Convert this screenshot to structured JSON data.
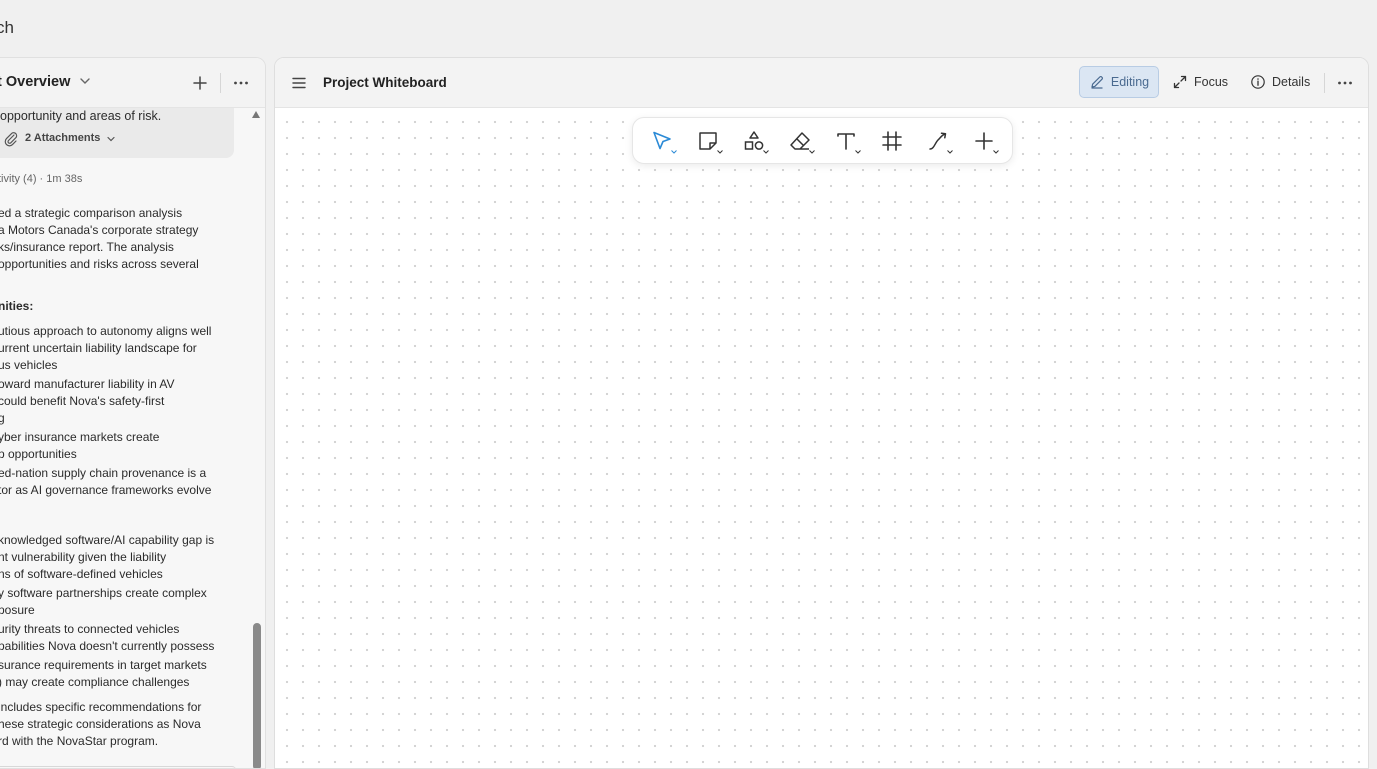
{
  "app": {
    "title_partial": "ch"
  },
  "left_panel": {
    "title": "t Overview",
    "card": {
      "text": "opportunity and areas of risk.",
      "attachments_label": "2 Attachments"
    },
    "activity": "tivity (4) · 1m 38s",
    "intro_lines": [
      "ed a strategic comparison analysis",
      "a Motors Canada's corporate strategy",
      "ks/insurance report. The analysis",
      " opportunities and risks across several"
    ],
    "opportunities_heading": "nities:",
    "opportunities_lines": [
      "utious approach to autonomy aligns well",
      "urrent uncertain liability landscape for",
      "us vehicles",
      "oward manufacturer liability in AV",
      "could benefit Nova's safety-first",
      "g",
      "yber insurance markets create",
      "p opportunities",
      "ed-nation supply chain provenance is a",
      "tor as AI governance frameworks evolve"
    ],
    "risks_lines": [
      "knowledged software/AI capability gap is",
      "nt vulnerability given the liability",
      "ns of software-defined vehicles",
      "y software partnerships create complex",
      "posure",
      "urity threats to connected vehicles",
      "pabilities Nova doesn't currently possess",
      "surance requirements in target markets",
      ") may create compliance challenges"
    ],
    "closing_lines": [
      "includes specific recommendations for",
      "hese strategic considerations as Nova",
      "rd with the NovaStar program."
    ]
  },
  "right_panel": {
    "title": "Project Whiteboard",
    "editing_label": "Editing",
    "focus_label": "Focus",
    "details_label": "Details"
  },
  "toolbar": {
    "tools": [
      {
        "name": "select",
        "icon": "cursor-arrow-icon",
        "active": true
      },
      {
        "name": "note",
        "icon": "sticky-note-icon"
      },
      {
        "name": "shapes",
        "icon": "shapes-icon"
      },
      {
        "name": "eraser",
        "icon": "eraser-icon"
      },
      {
        "name": "text",
        "icon": "text-icon"
      },
      {
        "name": "frame",
        "icon": "frame-hash-icon"
      },
      {
        "name": "connector",
        "icon": "connector-icon"
      },
      {
        "name": "add",
        "icon": "plus-icon"
      }
    ]
  },
  "colors": {
    "accent": "#2b8ad6",
    "editing_bg": "#dbe6f3",
    "editing_border": "#b8cce4"
  }
}
